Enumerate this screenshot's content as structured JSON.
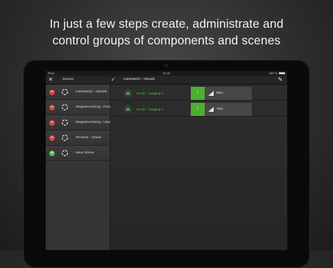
{
  "headline": {
    "line1": "In just a few steps create, administrate and",
    "line2": "control groups of components and scenes"
  },
  "statusbar": {
    "device": "iPad",
    "time": "11:42",
    "battery": "100 %"
  },
  "toolbar_left": {
    "close_icon": "close-icon",
    "title": "Szenen"
  },
  "toolbar_right": {
    "check_icon": "check-icon",
    "title": "Gartenteich - Abends",
    "edit_icon": "pencil-icon"
  },
  "scenes": [
    {
      "label": "Gartenteich - Abends",
      "action": "delete",
      "symbol": "−",
      "color": "#d94a4a"
    },
    {
      "label": "Wegbeleuchtung - Party",
      "action": "delete",
      "symbol": "−",
      "color": "#d94a4a"
    },
    {
      "label": "Wegbeleuchtung - Urlaub",
      "action": "delete",
      "symbol": "−",
      "color": "#d94a4a"
    },
    {
      "label": "Terrasse - Urlaub",
      "action": "delete",
      "symbol": "−",
      "color": "#d94a4a"
    },
    {
      "label": "Neue Szene",
      "action": "add",
      "symbol": "+",
      "color": "#4cc04c"
    }
  ],
  "components": [
    {
      "label": "M-150 - Ausgang 3",
      "level_index": "1",
      "percent": "59%",
      "level": 0.59
    },
    {
      "label": "M-150 - Ausgang 4",
      "level_index": "1",
      "percent": "76%",
      "level": 0.76
    }
  ],
  "colors": {
    "accent_green": "#4caf2f",
    "label_green": "#55c055",
    "delete_red": "#d94a4a",
    "add_green": "#4cc04c"
  }
}
